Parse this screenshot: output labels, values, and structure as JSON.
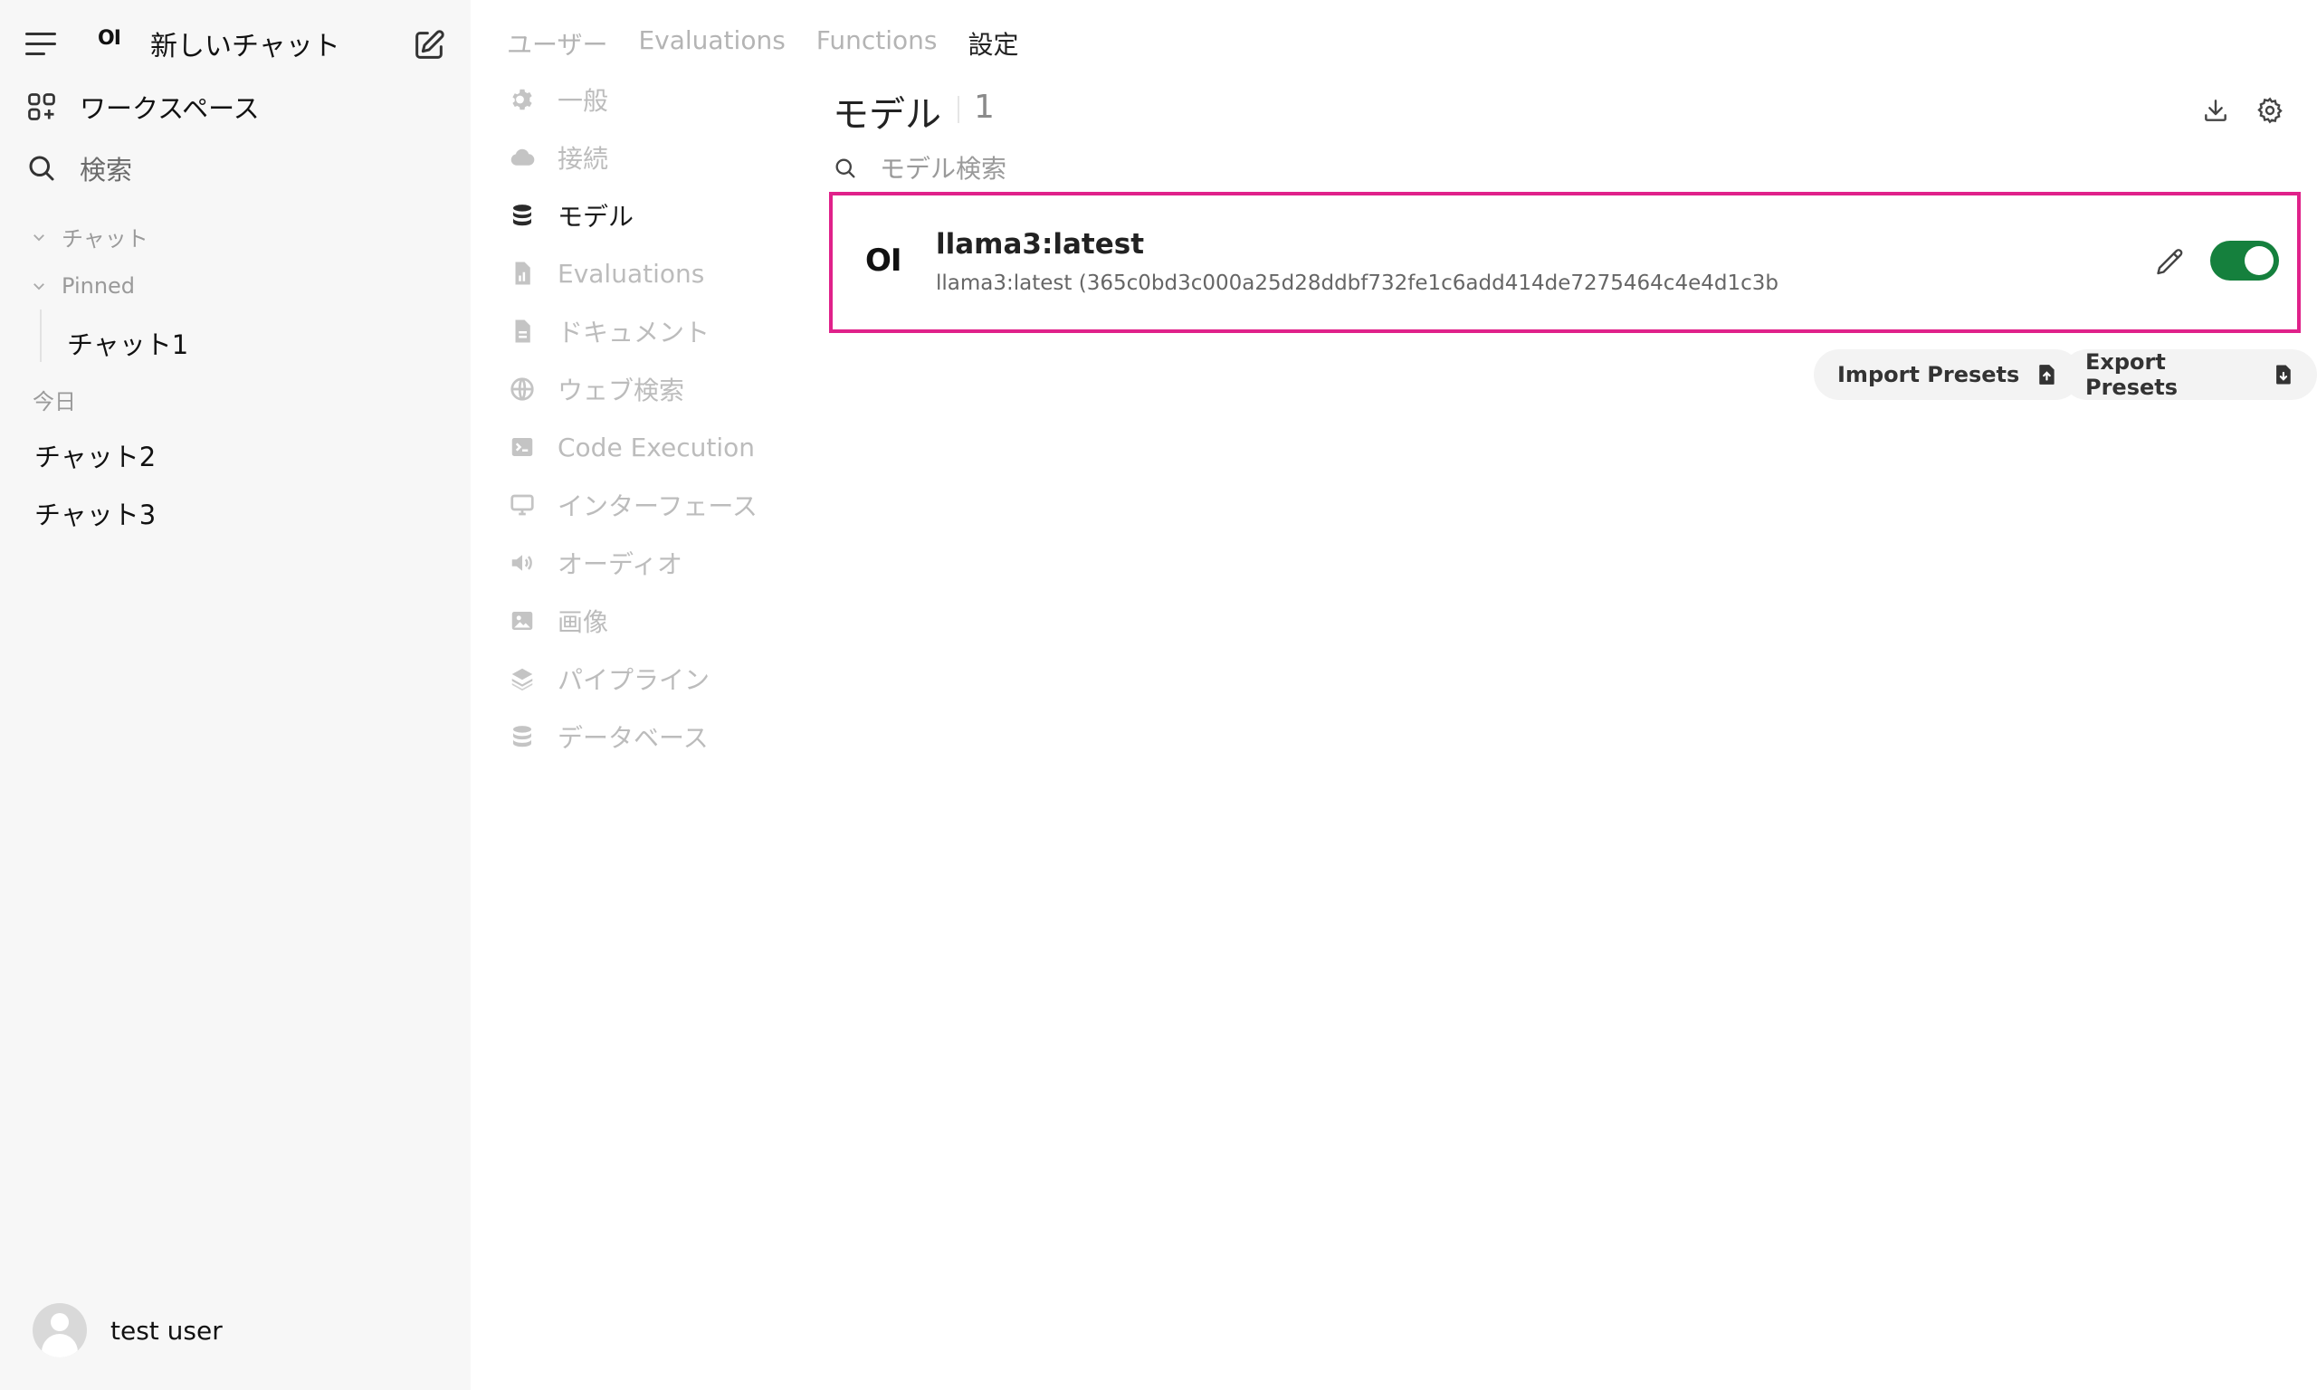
{
  "sidebar": {
    "brand_logo": "OI",
    "new_chat_label": "新しいチャット",
    "workspace_label": "ワークスペース",
    "search_label": "検索",
    "sections": {
      "chats": "チャット",
      "pinned": "Pinned",
      "today": "今日"
    },
    "pinned_chats": [
      "チャット1"
    ],
    "today_chats": [
      "チャット2",
      "チャット3"
    ],
    "user_name": "test user"
  },
  "tabs": [
    {
      "label": "ユーザー",
      "active": false
    },
    {
      "label": "Evaluations",
      "active": false
    },
    {
      "label": "Functions",
      "active": false
    },
    {
      "label": "設定",
      "active": true
    }
  ],
  "settings_nav": [
    {
      "label": "一般",
      "icon": "gear-icon",
      "active": false
    },
    {
      "label": "接続",
      "icon": "cloud-icon",
      "active": false
    },
    {
      "label": "モデル",
      "icon": "database-icon",
      "active": true
    },
    {
      "label": "Evaluations",
      "icon": "document-chart-icon",
      "active": false
    },
    {
      "label": "ドキュメント",
      "icon": "document-icon",
      "active": false
    },
    {
      "label": "ウェブ検索",
      "icon": "globe-icon",
      "active": false
    },
    {
      "label": "Code Execution",
      "icon": "terminal-icon",
      "active": false
    },
    {
      "label": "インターフェース",
      "icon": "monitor-icon",
      "active": false
    },
    {
      "label": "オーディオ",
      "icon": "speaker-icon",
      "active": false
    },
    {
      "label": "画像",
      "icon": "image-icon",
      "active": false
    },
    {
      "label": "パイプライン",
      "icon": "layers-icon",
      "active": false
    },
    {
      "label": "データベース",
      "icon": "database-icon",
      "active": false
    }
  ],
  "models_page": {
    "title": "モデル",
    "count": "1",
    "search_placeholder": "モデル検索",
    "models": [
      {
        "logo": "OI",
        "name": "llama3:latest",
        "description": "llama3:latest (365c0bd3c000a25d28ddbf732fe1c6add414de7275464c4e4d1c3b",
        "enabled": true
      }
    ],
    "import_presets_label": "Import Presets",
    "export_presets_label": "Export Presets"
  },
  "colors": {
    "highlight_border": "#e0218a",
    "toggle_on": "#15803d",
    "sidebar_bg": "#f7f7f7"
  }
}
